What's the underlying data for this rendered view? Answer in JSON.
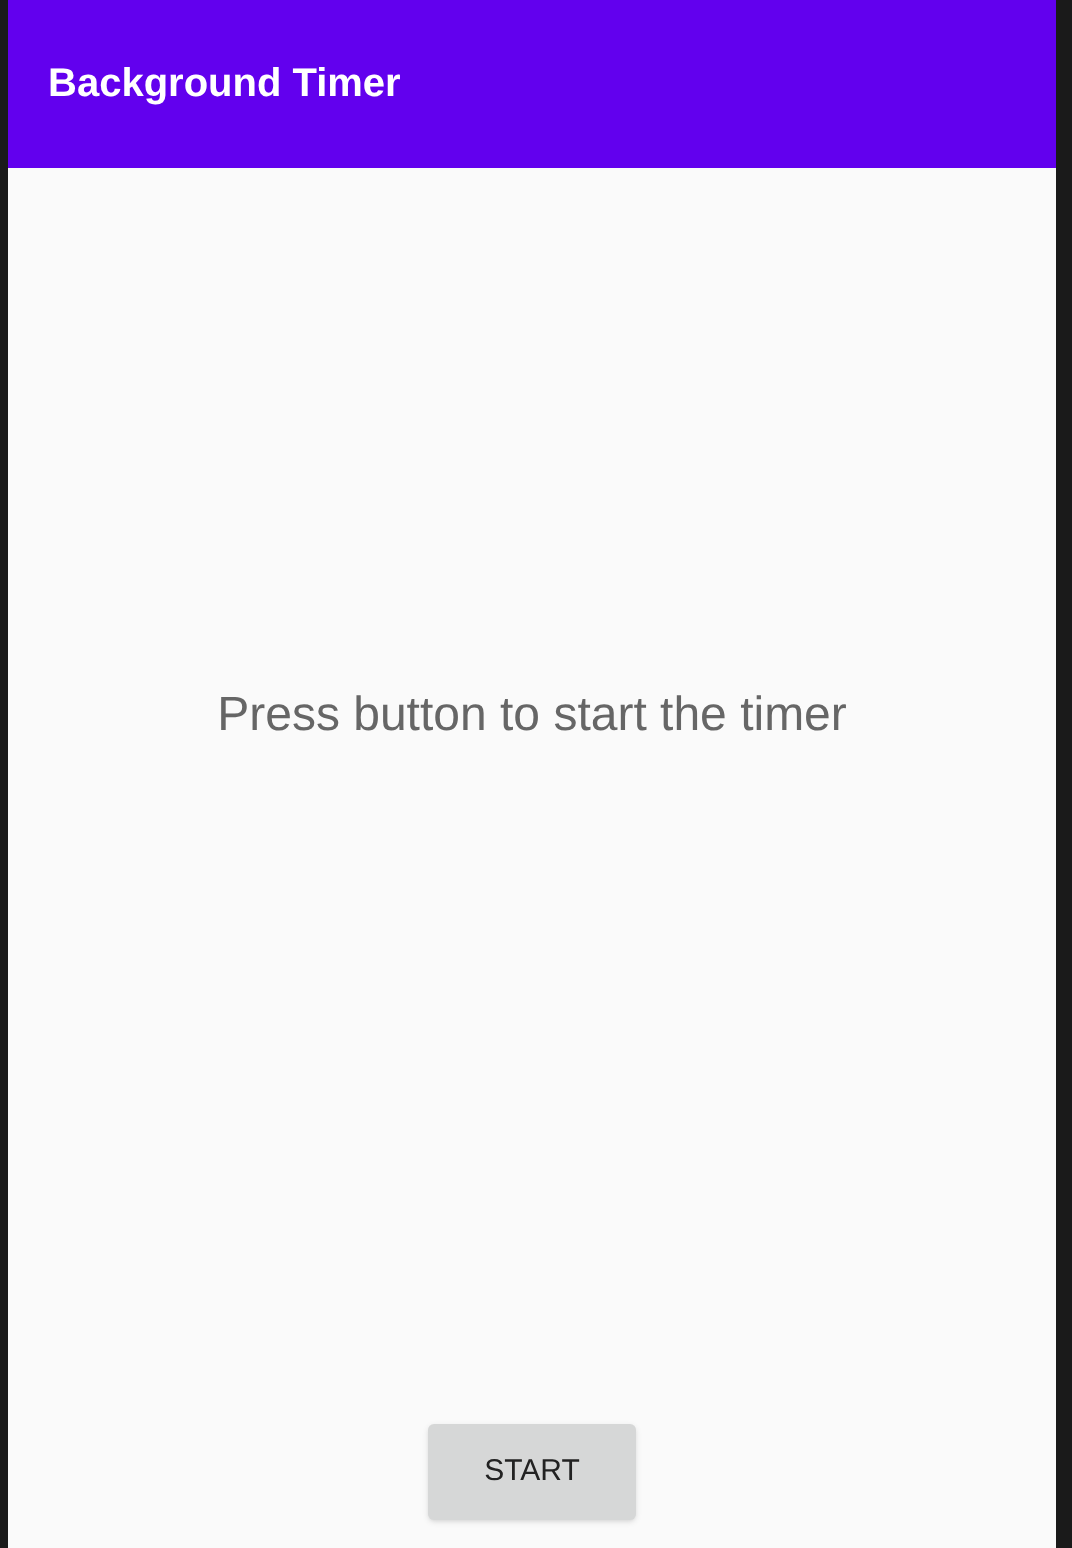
{
  "app_bar": {
    "title": "Background Timer"
  },
  "message": "Press button to start the timer",
  "button": {
    "label": "START"
  }
}
